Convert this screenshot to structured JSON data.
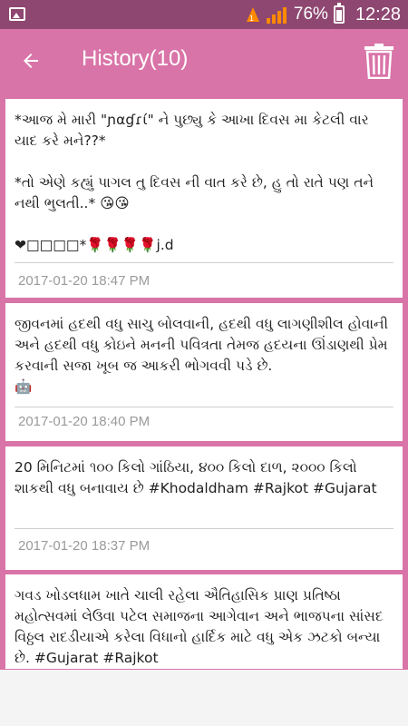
{
  "status_bar": {
    "battery_percent": "76%",
    "battery_level": 0.76,
    "time": "12:28",
    "accent_color": "#ff8a00"
  },
  "app_bar": {
    "title": "History(10)",
    "back_icon": "arrow-left",
    "delete_icon": "trash-can",
    "background_color": "#d974a8"
  },
  "history": [
    {
      "message": "*આજ મે મારી \"ɲαɠɾί\" ને પુછ્યુ કે આખા દિવસ મા કેટલી વાર યાદ કરે મને??*\n\n*તો એણે કહ્યું પાગલ તુ દિવસ ની વાત કરે છે, હુ તો રાતે પણ તને નથી ભુલતી..* 😘😘\n\n❤□□□□*🌹🌹🌹🌹j.d",
      "timestamp": "2017-01-20 18:47 PM"
    },
    {
      "message": "જીવનમાં હદથી વધુ સાચુ બોલવાની, હદથી વધુ લાગણીશીલ હોવાની અને હદથી વધુ કોઇને મનની પવિત્રતા તેમજ હદયના ઊંડાણથી પ્રેમ કરવાની સજા ખૂબ જ આકરી ભોગવવી પડે છે.\n🤖",
      "timestamp": "2017-01-20 18:40 PM"
    },
    {
      "message": "20 મિનિટમાં ૧૦૦ કિલો ગાંઠિયા, ૪૦૦ કિલો દાળ, ૨૦૦૦ કિલો શાકથી વધુ બનાવાય છે #Khodaldham #Rajkot #Gujarat",
      "timestamp": "2017-01-20 18:37 PM"
    },
    {
      "message": "ગવડ ખોડલધામ ખાતે ચાલી રહેલા ઐતિહાસિક પ્રાણ પ્રતિષ્ઠા મહોત્સવમાં લેઉવા પટેલ સમાજના આગેવાન અને ભાજપના સાંસદ વિઠ્ઠલ રાદડીયાએ કરેલા વિધાનો હાર્દિક માટે વધુ એક ઝટકો બન્યા છે. #Gujarat #Rajkot",
      "timestamp": ""
    }
  ]
}
